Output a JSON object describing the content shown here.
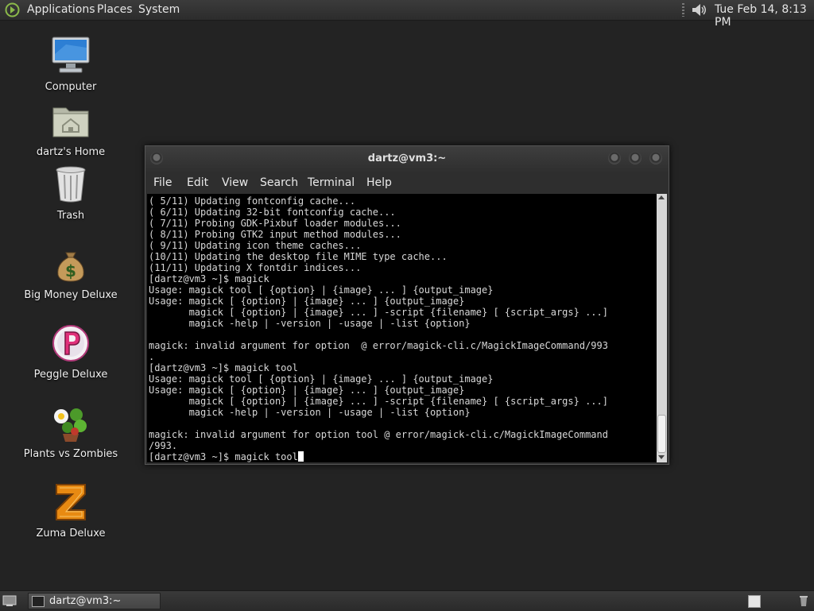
{
  "top_panel": {
    "menus": [
      "Applications",
      "Places",
      "System"
    ],
    "clock": "Tue Feb 14,  8:13 PM",
    "icons": [
      "distro-logo-icon",
      "volume-icon"
    ]
  },
  "desktop_icons": [
    {
      "label": "Computer",
      "icon": "computer-icon"
    },
    {
      "label": "dartz's Home",
      "icon": "home-folder-icon"
    },
    {
      "label": "Trash",
      "icon": "trash-icon"
    },
    {
      "label": "Big Money Deluxe",
      "icon": "money-bag-icon"
    },
    {
      "label": "Peggle Deluxe",
      "icon": "peggle-icon"
    },
    {
      "label": "Plants vs Zombies",
      "icon": "plants-vs-zombies-icon"
    },
    {
      "label": "Zuma Deluxe",
      "icon": "zuma-icon"
    }
  ],
  "terminal": {
    "title": "dartz@vm3:~",
    "menu": [
      "File",
      "Edit",
      "View",
      "Search",
      "Terminal",
      "Help"
    ],
    "output": "( 5/11) Updating fontconfig cache...\n( 6/11) Updating 32-bit fontconfig cache...\n( 7/11) Probing GDK-Pixbuf loader modules...\n( 8/11) Probing GTK2 input method modules...\n( 9/11) Updating icon theme caches...\n(10/11) Updating the desktop file MIME type cache...\n(11/11) Updating X fontdir indices...\n[dartz@vm3 ~]$ magick\nUsage: magick tool [ {option} | {image} ... ] {output_image}\nUsage: magick [ {option} | {image} ... ] {output_image}\n       magick [ {option} | {image} ... ] -script {filename} [ {script_args} ...]\n       magick -help | -version | -usage | -list {option}\n\nmagick: invalid argument for option  @ error/magick-cli.c/MagickImageCommand/993\n.\n[dartz@vm3 ~]$ magick tool\nUsage: magick tool [ {option} | {image} ... ] {output_image}\nUsage: magick [ {option} | {image} ... ] {output_image}\n       magick [ {option} | {image} ... ] -script {filename} [ {script_args} ...]\n       magick -help | -version | -usage | -list {option}\n\nmagick: invalid argument for option tool @ error/magick-cli.c/MagickImageCommand\n/993.\n[dartz@vm3 ~]$ magick tool",
    "colors": {
      "background": "#000000",
      "foreground": "#d8d8d8"
    }
  },
  "bottom_panel": {
    "task": "dartz@vm3:~"
  }
}
